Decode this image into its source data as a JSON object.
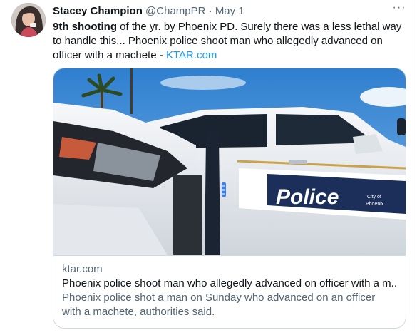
{
  "tweet": {
    "author_name": "Stacey Champion",
    "handle": "@ChampPR",
    "separator": "·",
    "date": "May 1",
    "more_label": "···",
    "text_bold": "9th shooting",
    "text_main": " of the yr. by Phoenix PD. Surely there was a less lethal way to handle this... Phoenix police shoot man who allegedly advanced on officer with a machete - ",
    "link_text": "KTAR.com"
  },
  "card": {
    "domain": "ktar.com",
    "title": "Phoenix police shoot man who allegedly advanced on officer with a m...",
    "description": "Phoenix police shot a man on Sunday who advanced on an officer with a machete, authorities said.",
    "image_door_text": "Police",
    "image_seal_line1": "City of",
    "image_seal_line2": "Phoenix"
  },
  "colors": {
    "link": "#1d9bf0",
    "secondary_text": "#536471",
    "border": "#cfd9de",
    "sky": "#3f8fd8",
    "vehicle_white": "#eef1f4",
    "police_blue": "#1b2f5a"
  }
}
